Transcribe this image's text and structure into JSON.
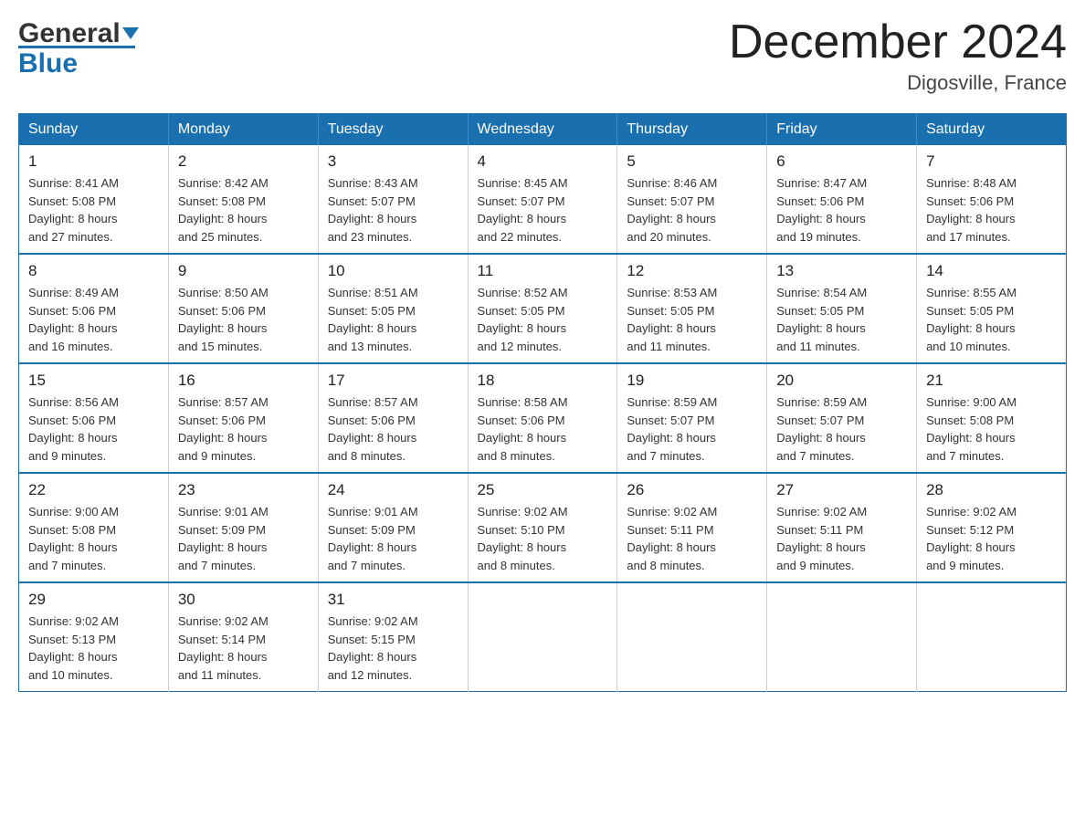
{
  "header": {
    "logo_general": "General",
    "logo_blue": "Blue",
    "month_title": "December 2024",
    "location": "Digosville, France"
  },
  "days_of_week": [
    "Sunday",
    "Monday",
    "Tuesday",
    "Wednesday",
    "Thursday",
    "Friday",
    "Saturday"
  ],
  "weeks": [
    [
      {
        "day": "1",
        "sunrise": "8:41 AM",
        "sunset": "5:08 PM",
        "daylight": "8 hours and 27 minutes."
      },
      {
        "day": "2",
        "sunrise": "8:42 AM",
        "sunset": "5:08 PM",
        "daylight": "8 hours and 25 minutes."
      },
      {
        "day": "3",
        "sunrise": "8:43 AM",
        "sunset": "5:07 PM",
        "daylight": "8 hours and 23 minutes."
      },
      {
        "day": "4",
        "sunrise": "8:45 AM",
        "sunset": "5:07 PM",
        "daylight": "8 hours and 22 minutes."
      },
      {
        "day": "5",
        "sunrise": "8:46 AM",
        "sunset": "5:07 PM",
        "daylight": "8 hours and 20 minutes."
      },
      {
        "day": "6",
        "sunrise": "8:47 AM",
        "sunset": "5:06 PM",
        "daylight": "8 hours and 19 minutes."
      },
      {
        "day": "7",
        "sunrise": "8:48 AM",
        "sunset": "5:06 PM",
        "daylight": "8 hours and 17 minutes."
      }
    ],
    [
      {
        "day": "8",
        "sunrise": "8:49 AM",
        "sunset": "5:06 PM",
        "daylight": "8 hours and 16 minutes."
      },
      {
        "day": "9",
        "sunrise": "8:50 AM",
        "sunset": "5:06 PM",
        "daylight": "8 hours and 15 minutes."
      },
      {
        "day": "10",
        "sunrise": "8:51 AM",
        "sunset": "5:05 PM",
        "daylight": "8 hours and 13 minutes."
      },
      {
        "day": "11",
        "sunrise": "8:52 AM",
        "sunset": "5:05 PM",
        "daylight": "8 hours and 12 minutes."
      },
      {
        "day": "12",
        "sunrise": "8:53 AM",
        "sunset": "5:05 PM",
        "daylight": "8 hours and 11 minutes."
      },
      {
        "day": "13",
        "sunrise": "8:54 AM",
        "sunset": "5:05 PM",
        "daylight": "8 hours and 11 minutes."
      },
      {
        "day": "14",
        "sunrise": "8:55 AM",
        "sunset": "5:05 PM",
        "daylight": "8 hours and 10 minutes."
      }
    ],
    [
      {
        "day": "15",
        "sunrise": "8:56 AM",
        "sunset": "5:06 PM",
        "daylight": "8 hours and 9 minutes."
      },
      {
        "day": "16",
        "sunrise": "8:57 AM",
        "sunset": "5:06 PM",
        "daylight": "8 hours and 9 minutes."
      },
      {
        "day": "17",
        "sunrise": "8:57 AM",
        "sunset": "5:06 PM",
        "daylight": "8 hours and 8 minutes."
      },
      {
        "day": "18",
        "sunrise": "8:58 AM",
        "sunset": "5:06 PM",
        "daylight": "8 hours and 8 minutes."
      },
      {
        "day": "19",
        "sunrise": "8:59 AM",
        "sunset": "5:07 PM",
        "daylight": "8 hours and 7 minutes."
      },
      {
        "day": "20",
        "sunrise": "8:59 AM",
        "sunset": "5:07 PM",
        "daylight": "8 hours and 7 minutes."
      },
      {
        "day": "21",
        "sunrise": "9:00 AM",
        "sunset": "5:08 PM",
        "daylight": "8 hours and 7 minutes."
      }
    ],
    [
      {
        "day": "22",
        "sunrise": "9:00 AM",
        "sunset": "5:08 PM",
        "daylight": "8 hours and 7 minutes."
      },
      {
        "day": "23",
        "sunrise": "9:01 AM",
        "sunset": "5:09 PM",
        "daylight": "8 hours and 7 minutes."
      },
      {
        "day": "24",
        "sunrise": "9:01 AM",
        "sunset": "5:09 PM",
        "daylight": "8 hours and 7 minutes."
      },
      {
        "day": "25",
        "sunrise": "9:02 AM",
        "sunset": "5:10 PM",
        "daylight": "8 hours and 8 minutes."
      },
      {
        "day": "26",
        "sunrise": "9:02 AM",
        "sunset": "5:11 PM",
        "daylight": "8 hours and 8 minutes."
      },
      {
        "day": "27",
        "sunrise": "9:02 AM",
        "sunset": "5:11 PM",
        "daylight": "8 hours and 9 minutes."
      },
      {
        "day": "28",
        "sunrise": "9:02 AM",
        "sunset": "5:12 PM",
        "daylight": "8 hours and 9 minutes."
      }
    ],
    [
      {
        "day": "29",
        "sunrise": "9:02 AM",
        "sunset": "5:13 PM",
        "daylight": "8 hours and 10 minutes."
      },
      {
        "day": "30",
        "sunrise": "9:02 AM",
        "sunset": "5:14 PM",
        "daylight": "8 hours and 11 minutes."
      },
      {
        "day": "31",
        "sunrise": "9:02 AM",
        "sunset": "5:15 PM",
        "daylight": "8 hours and 12 minutes."
      },
      null,
      null,
      null,
      null
    ]
  ]
}
